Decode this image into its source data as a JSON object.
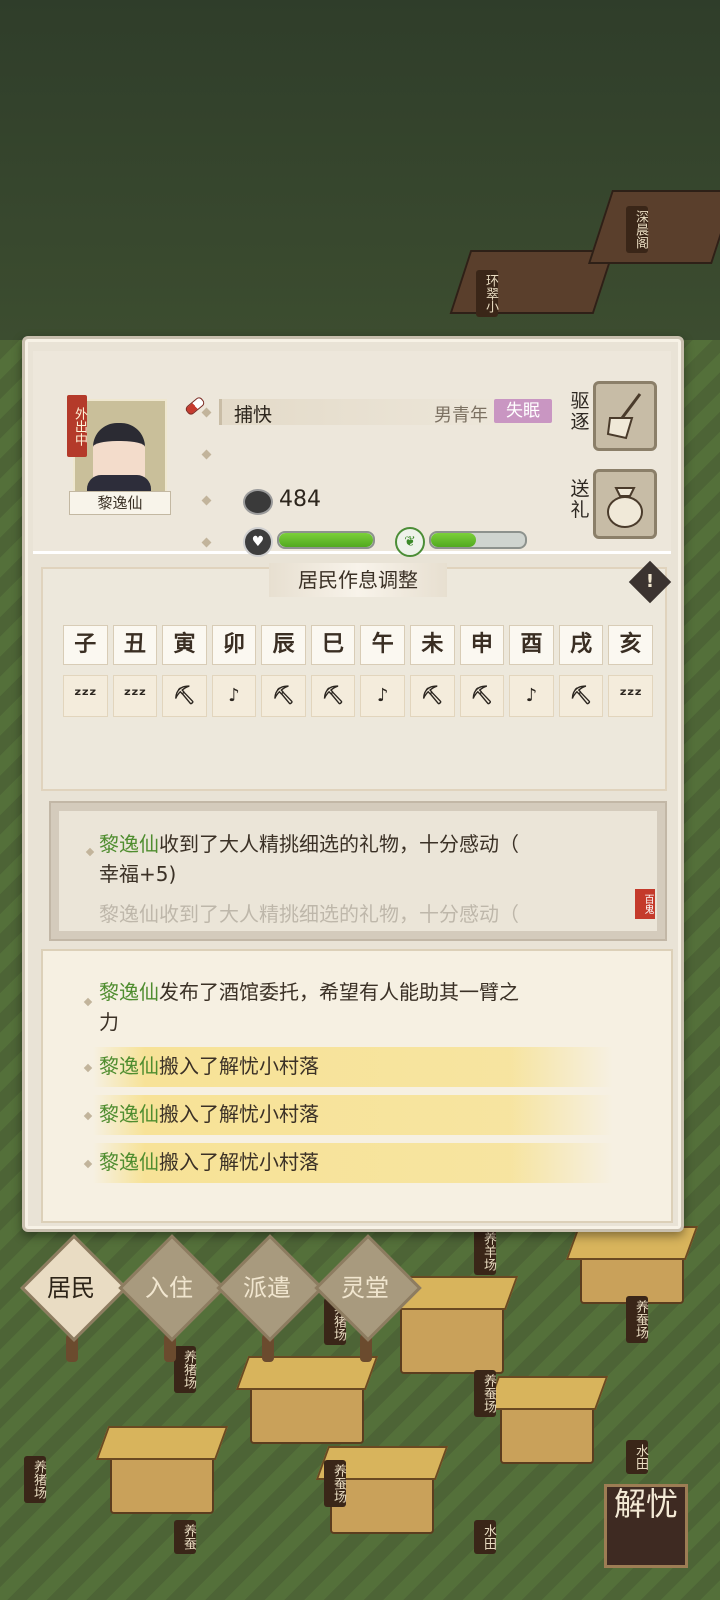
{
  "resident": {
    "name": "黎逸仙",
    "status_badge": "外出中",
    "job": "捕快",
    "meta": "男青年",
    "trait_tag": "失眠",
    "wealth": "484",
    "health_fraction": 1.0,
    "mood_fraction": 0.48
  },
  "actions": {
    "expel_label": "驱逐",
    "gift_label": "送礼"
  },
  "schedule": {
    "title": "居民作息调整",
    "hours": [
      "子",
      "丑",
      "寅",
      "卯",
      "辰",
      "巳",
      "午",
      "未",
      "申",
      "酉",
      "戌",
      "亥"
    ],
    "activities": [
      "sleep",
      "sleep",
      "work",
      "leisure",
      "work",
      "work",
      "leisure",
      "work",
      "work",
      "leisure",
      "work",
      "sleep"
    ],
    "activity_glyphs": {
      "sleep": "ᶻᶻᶻ",
      "work": "⛏",
      "leisure": "♪"
    }
  },
  "log_recent": {
    "line1_name": "黎逸仙",
    "line1_text": "收到了大人精挑细选的礼物，十分感动（",
    "line2_text": "幸福+5)",
    "line3_faded": "黎逸仙收到了大人精挑细选的礼物，十分感动（",
    "seal": "百鬼"
  },
  "log_history": {
    "entry1_name": "黎逸仙",
    "entry1_text": "发布了酒馆委托，希望有人能助其一臂之",
    "entry1_text2": "力",
    "entries": [
      {
        "name": "黎逸仙",
        "text": "搬入了解忧小村落"
      },
      {
        "name": "黎逸仙",
        "text": "搬入了解忧小村落"
      },
      {
        "name": "黎逸仙",
        "text": "搬入了解忧小村落"
      }
    ]
  },
  "nav": {
    "residents": "居民",
    "move_in": "入住",
    "dispatch": "派遣",
    "spirit_hall": "灵堂"
  },
  "map_signs": [
    "深晨阁",
    "环翠小",
    "养羊场",
    "养蚕场",
    "养猪场",
    "养猪场",
    "养蚕场",
    "养猪场",
    "养蚕场",
    "水田",
    "养蚕",
    "水田"
  ],
  "corner_logo": "解忧"
}
